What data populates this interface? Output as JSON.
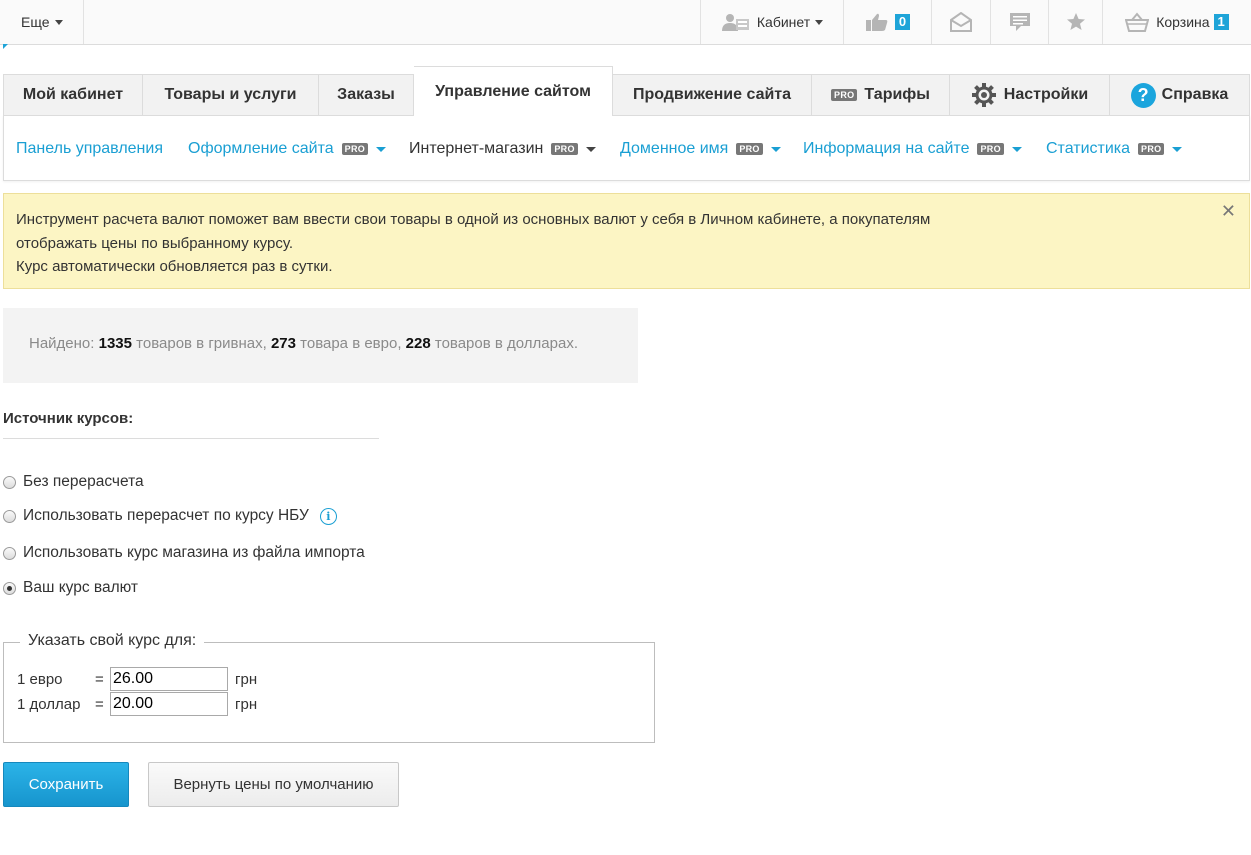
{
  "topbar": {
    "more_label": "Еще",
    "cabinet_label": "Кабинет",
    "likes_count": "0",
    "cart_label": "Корзина",
    "cart_count": "1"
  },
  "tabs": [
    {
      "label": "Мой кабинет"
    },
    {
      "label": "Товары и услуги"
    },
    {
      "label": "Заказы"
    },
    {
      "label": "Управление сайтом"
    },
    {
      "label": "Продвижение сайта"
    },
    {
      "label": "Тарифы",
      "pro": "PRO"
    },
    {
      "label": "Настройки"
    },
    {
      "label": "Справка"
    }
  ],
  "subnav": [
    {
      "label": "Панель управления"
    },
    {
      "label": "Оформление сайта",
      "pro": "PRO"
    },
    {
      "label": "Интернет-магазин",
      "pro": "PRO"
    },
    {
      "label": "Доменное имя",
      "pro": "PRO"
    },
    {
      "label": "Информация на сайте",
      "pro": "PRO"
    },
    {
      "label": "Статистика",
      "pro": "PRO"
    }
  ],
  "alert": {
    "line1": "Инструмент расчета валют поможет вам ввести свои товары в одной из основных валют у себя в Личном кабинете, а покупателям",
    "line2": "отображать цены по выбранному курсу.",
    "line3": "Курс автоматически обновляется раз в сутки.",
    "close": "✕"
  },
  "found": {
    "prefix": "Найдено:",
    "uah_count": "1335",
    "uah_text": "товаров в гривнах,",
    "eur_count": "273",
    "eur_text": "товара в евро,",
    "usd_count": "228",
    "usd_text": "товаров в долларах."
  },
  "source": {
    "title": "Источник курсов:",
    "options": [
      {
        "label": "Без перерасчета",
        "checked": false
      },
      {
        "label": "Использовать перерасчет по курсу НБУ",
        "checked": false
      },
      {
        "label": "Использовать курс магазина из файла импорта",
        "checked": false
      },
      {
        "label": "Ваш курс валют",
        "checked": true
      }
    ]
  },
  "rates": {
    "legend": "Указать свой курс для:",
    "eur_label": "1 евро",
    "usd_label": "1 доллар",
    "eq": "=",
    "eur_value": "26.00",
    "usd_value": "20.00",
    "unit": "грн"
  },
  "buttons": {
    "save": "Сохранить",
    "reset": "Вернуть цены по умолчанию"
  },
  "colors": {
    "accent": "#1a9fd3",
    "alert_bg": "#fcf5c4"
  }
}
